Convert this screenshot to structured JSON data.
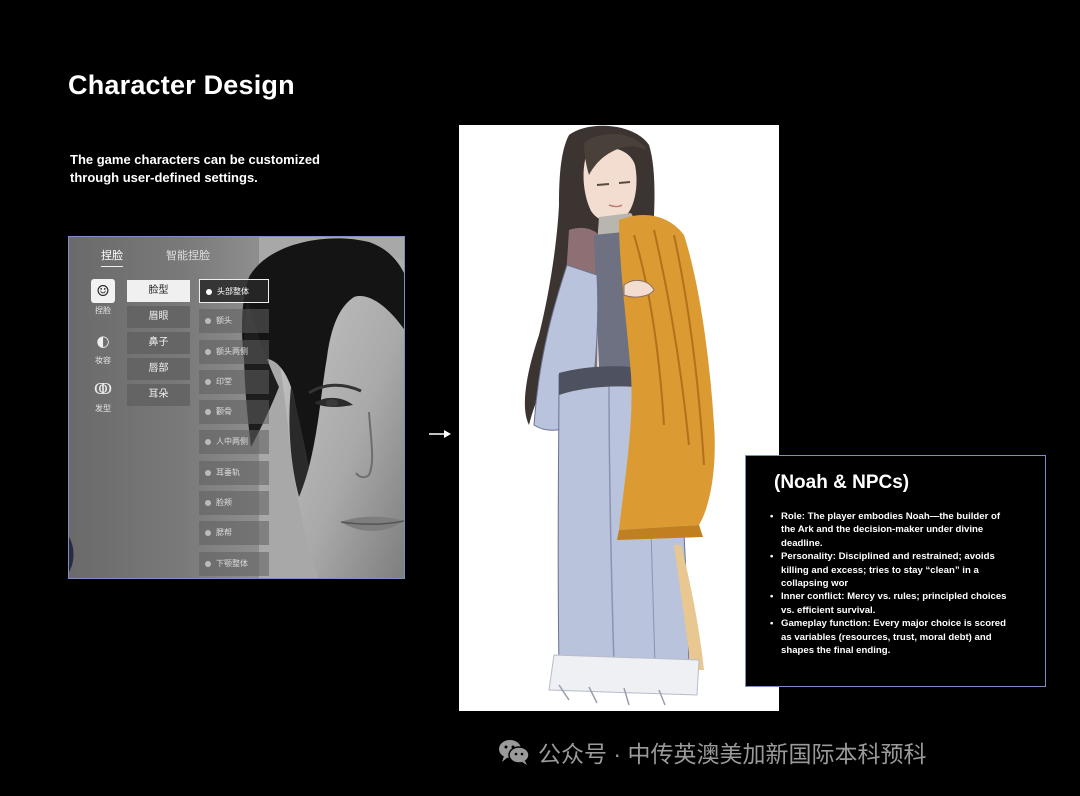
{
  "page": {
    "title": "Character Design",
    "subtitle": "The game characters can be customized through user-defined settings."
  },
  "game_ui": {
    "tabs": [
      {
        "label": "捏脸",
        "active": true
      },
      {
        "label": "智能捏脸",
        "active": false
      }
    ],
    "categories": [
      {
        "label": "捏脸",
        "icon": "face-icon",
        "active": true
      },
      {
        "label": "妆容",
        "icon": "makeup-icon",
        "active": false
      },
      {
        "label": "发型",
        "icon": "hair-icon",
        "active": false
      }
    ],
    "face_parts": [
      {
        "label": "脸型",
        "active": true
      },
      {
        "label": "眉眼",
        "active": false
      },
      {
        "label": "鼻子",
        "active": false
      },
      {
        "label": "唇部",
        "active": false
      },
      {
        "label": "耳朵",
        "active": false
      }
    ],
    "sub_parts": [
      {
        "label": "头部整体",
        "active": true
      },
      {
        "label": "额头",
        "active": false
      },
      {
        "label": "额头两侧",
        "active": false
      },
      {
        "label": "印堂",
        "active": false
      },
      {
        "label": "颧骨",
        "active": false
      },
      {
        "label": "人中两侧",
        "active": false
      },
      {
        "label": "耳垂轨",
        "active": false
      },
      {
        "label": "脸颊",
        "active": false
      },
      {
        "label": "腮帮",
        "active": false
      },
      {
        "label": "下颚整体",
        "active": false
      }
    ]
  },
  "card": {
    "title": "(Noah & NPCs)",
    "bullets": [
      "Role: The player embodies Noah—the builder of the Ark and the decision-maker under divine deadline.",
      "Personality: Disciplined and restrained; avoids killing and excess; tries to stay “clean” in a collapsing wor",
      "Inner conflict: Mercy vs. rules; principled choices vs. efficient survival.",
      "Gameplay function: Every major choice is scored as variables (resources, trust, moral debt) and shapes the final ending."
    ]
  },
  "watermark": {
    "text": "公众号 · 中传英澳美加新国际本科预科",
    "icon": "wechat-icon"
  },
  "colors": {
    "background": "#000000",
    "panel_border": "#7b8fc2",
    "robe": "#b9c3dc",
    "shawl": "#dc9a32",
    "watermark": "#9a9a9a"
  }
}
